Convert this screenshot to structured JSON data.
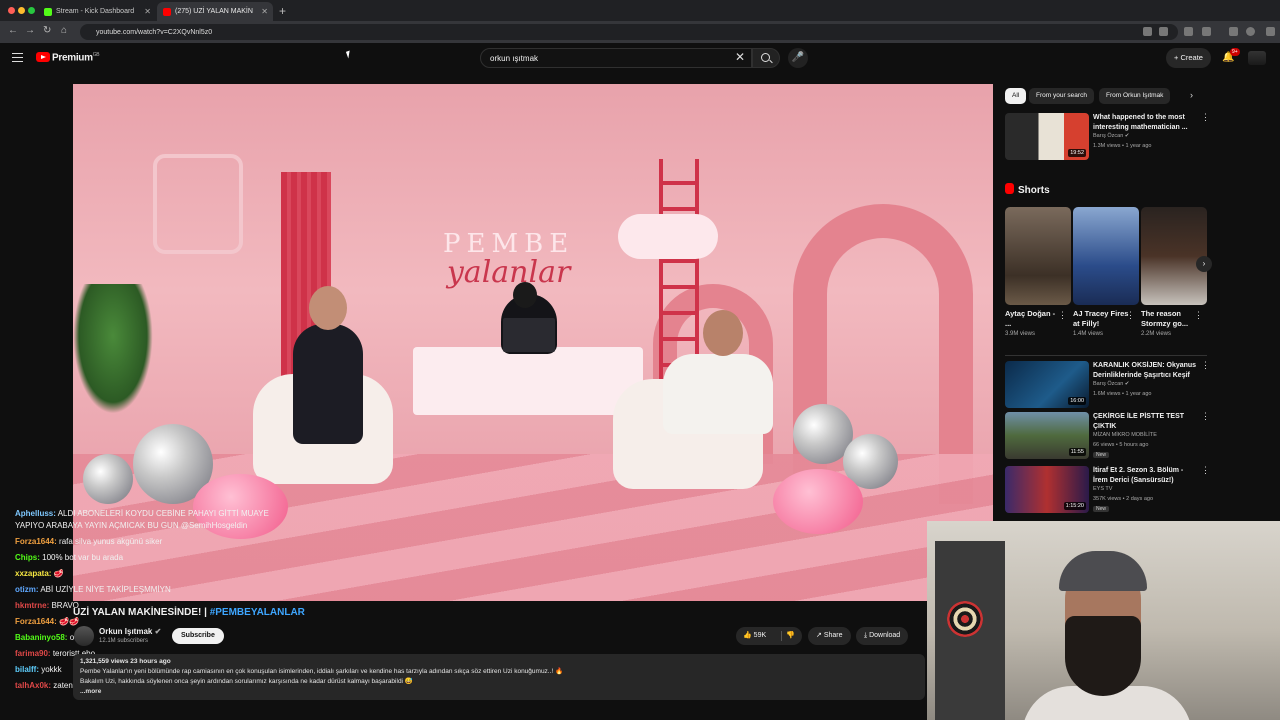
{
  "browser": {
    "tabs": [
      {
        "title": "Stream - Kick Dashboard",
        "active": false
      },
      {
        "title": "(275) UZİ YALAN MAKİN",
        "active": true
      }
    ],
    "url": "youtube.com/watch?v=C2XQvNnl5z0"
  },
  "header": {
    "brand": "Premium",
    "brand_sup": "GB",
    "search_value": "orkun ışıtmak",
    "create_label": "Create",
    "notif_count": "9+"
  },
  "video": {
    "stage_line1": "PEMBE",
    "stage_line2": "yalanlar",
    "title_main": "UZİ YALAN MAKİNESİNDE! | ",
    "title_tag": "#PEMBEYALANLAR",
    "channel": "Orkun Işıtmak",
    "subscribers": "12.1M subscribers",
    "subscribe_label": "Subscribe",
    "likes": "59K",
    "share_label": "Share",
    "download_label": "Download",
    "views_time": "1,321,559 views  23 hours ago",
    "description_1": "Pembe Yalanlar'ın yeni bölümünde rap camiasının en çok konuşulan isimlerinden, iddialı şarkıları ve kendine has tarzıyla adından sıkça söz ettiren Uzi konuğumuz..! 🔥",
    "description_2": "Bakalım Uzi, hakkında söylenen onca şeyin ardından sorularımız karşısında ne kadar dürüst kalmayı başarabildi 😅",
    "more_label": "...more"
  },
  "chat": [
    {
      "user": "Aphelluss:",
      "text": "ALDI ABONELERİ KOYDU CEBİNE PAHAYI GİTTİ MUAYE YAPIYO ARABAYA YAYIN AÇMICAK BU GUN @SemihHosgeldin",
      "color": "#7ec8ff"
    },
    {
      "user": "Forza1644:",
      "text": "rafa silva yunus akgünü siker",
      "color": "#f0a040"
    },
    {
      "user": "Chips:",
      "text": "100% bot var bu arada",
      "color": "#53fc18"
    },
    {
      "user": "xxzapata:",
      "text": "🥩",
      "color": "#f5e642"
    },
    {
      "user": "otizm:",
      "text": "ABİ UZİYLE NİYE TAKİPLEŞMMİYN",
      "color": "#5fa8ff"
    },
    {
      "user": "hkmtrne:",
      "text": "BRAVO",
      "color": "#e04848"
    },
    {
      "user": "Forza1644:",
      "text": "🥩🥩",
      "color": "#f0a040"
    },
    {
      "user": "Babaninyo58:",
      "text": "oooo",
      "color": "#53fc18"
    },
    {
      "user": "farima90:",
      "text": "teroristt ebo",
      "color": "#e04848"
    },
    {
      "user": "bilalff:",
      "text": "yokkk",
      "color": "#5fd0ff"
    },
    {
      "user": "talhAx0k:",
      "text": "zaten var",
      "color": "#e04848"
    }
  ],
  "chips": [
    "All",
    "From your search",
    "From Orkun Işıtmak"
  ],
  "recommended_top": {
    "title": "What happened to the most interesting mathematician ...",
    "channel": "Barış Özcan ✔",
    "meta": "1.3M views • 1 year ago",
    "duration": "19:52"
  },
  "shorts_label": "Shorts",
  "shorts": [
    {
      "title": "Aytaç Doğan - ...",
      "views": "3.9M views"
    },
    {
      "title": "AJ Tracey Fires at Filly!",
      "views": "1.4M views"
    },
    {
      "title": "The reason Stormzy go...",
      "views": "2.2M views"
    }
  ],
  "recommended": [
    {
      "title": "KARANLIK OKSİJEN: Okyanus Derinliklerinde Şaşırtıcı Keşif",
      "channel": "Barış Özcan ✔",
      "meta": "1.6M views • 1 year ago",
      "duration": "16:00",
      "new": ""
    },
    {
      "title": "ÇEKİRGE İLE PİSTTE TEST ÇIKTIK",
      "channel": "MİZAN MİKRO MOBİLİTE",
      "meta": "66 views • 5 hours ago",
      "duration": "11:55",
      "new": "New"
    },
    {
      "title": "İtiraf Et 2. Sezon 3. Bölüm - İrem Derici (Sansürsüz!)",
      "channel": "EYS TV",
      "meta": "357K views • 2 days ago",
      "duration": "1:15:20",
      "new": "New"
    }
  ]
}
